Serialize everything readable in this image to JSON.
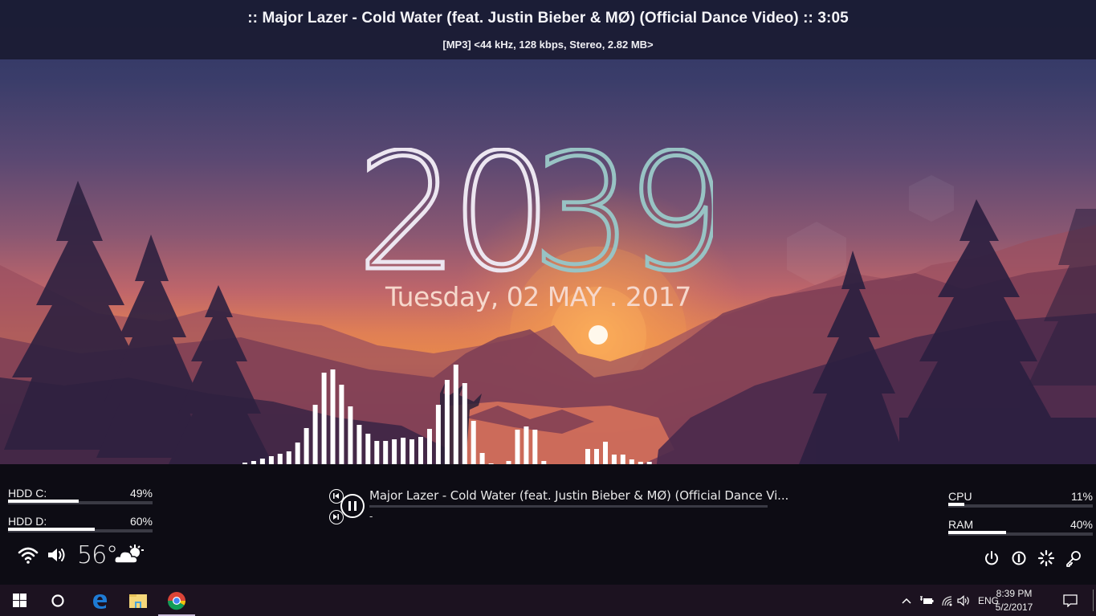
{
  "top_bar": {
    "now_playing": ":: Major Lazer - Cold Water (feat. Justin Bieber & MØ) (Official Dance Video) :: 3:05",
    "file_info": "[MP3] <44 kHz, 128 kbps, Stereo, 2.82 MB>"
  },
  "clock": {
    "hours": "20",
    "minutes": "39",
    "date": "Tuesday, 02 MAY . 2017",
    "hours_color": "#ece6f0",
    "minutes_color": "#98c3c4"
  },
  "visualizer": {
    "type": "bar",
    "bar_count": 47,
    "max_value": 124,
    "values": [
      2,
      4,
      7,
      10,
      13,
      16,
      27,
      45,
      74,
      114,
      118,
      99,
      72,
      49,
      38,
      29,
      29,
      31,
      33,
      31,
      34,
      44,
      74,
      105,
      124,
      101,
      54,
      14,
      1,
      0,
      4,
      43,
      47,
      43,
      4,
      0,
      0,
      0,
      0,
      19,
      19,
      28,
      12,
      12,
      6,
      3,
      3
    ],
    "color": "#ffffff"
  },
  "disks": [
    {
      "label": "HDD C:",
      "value": "49%",
      "percent": 49
    },
    {
      "label": "HDD D:",
      "value": "60%",
      "percent": 60
    }
  ],
  "system": [
    {
      "label": "CPU",
      "value": "11%",
      "percent": 11
    },
    {
      "label": "RAM",
      "value": "40%",
      "percent": 40
    }
  ],
  "status": {
    "wifi_icon": "wifi-icon",
    "volume_icon": "volume-icon",
    "temperature": "56°",
    "weather_icon": "partly-cloudy-icon"
  },
  "media_player": {
    "track": "Major Lazer - Cold Water (feat. Justin Bieber & MØ) (Official Dance Vi...",
    "subtitle": "-",
    "progress_percent": 0,
    "prev_icon": "skip-previous-icon",
    "play_pause_icon": "pause-icon",
    "next_icon": "skip-next-icon"
  },
  "system_buttons": [
    "power-icon",
    "info-icon",
    "loading-icon",
    "key-icon"
  ],
  "taskbar": {
    "apps": [
      "windows-start-icon",
      "cortana-icon",
      "edge-icon",
      "file-explorer-icon",
      "chrome-icon"
    ],
    "tray": {
      "language": "ENG",
      "time": "8:39 PM",
      "date": "5/2/2017"
    }
  }
}
